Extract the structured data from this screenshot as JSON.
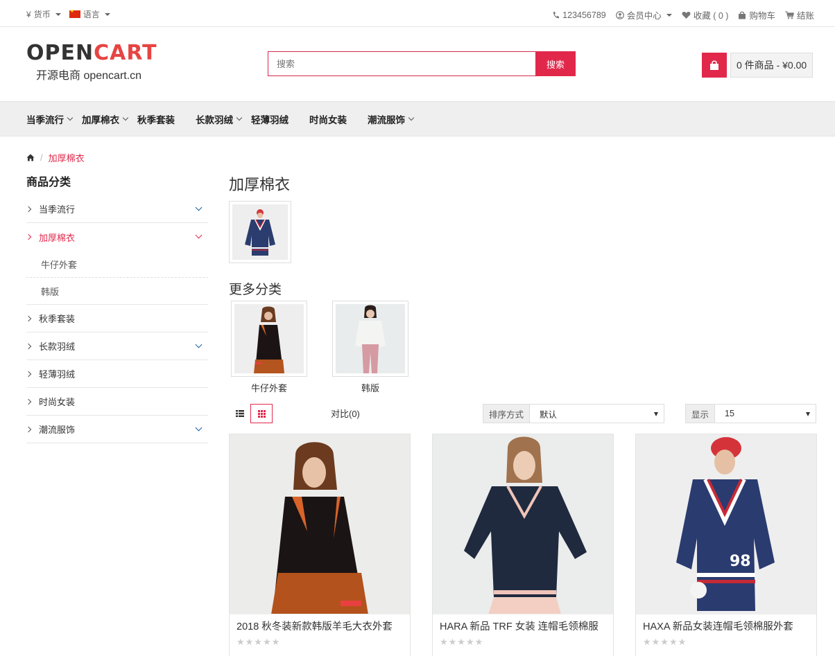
{
  "topbar": {
    "currency_symbol": "¥",
    "currency_label": "货币",
    "language_label": "语言",
    "phone": "123456789",
    "account_label": "会员中心",
    "wishlist_label": "收藏 ( 0 )",
    "cart_label": "购物车",
    "checkout_label": "结账"
  },
  "header": {
    "logo_part1": "OPEN",
    "logo_part2": "CART",
    "logo_tagline": "开源电商 opencart.cn",
    "search_placeholder": "搜索",
    "search_button": "搜索",
    "cart_total": "0 件商品 - ¥0.00"
  },
  "nav": {
    "items": [
      {
        "label": "当季流行",
        "dropdown": true
      },
      {
        "label": "加厚棉衣",
        "dropdown": true
      },
      {
        "label": "秋季套装",
        "dropdown": false
      },
      {
        "label": "长款羽绒",
        "dropdown": true
      },
      {
        "label": "轻薄羽绒",
        "dropdown": false
      },
      {
        "label": "时尚女装",
        "dropdown": false
      },
      {
        "label": "潮流服饰",
        "dropdown": true
      }
    ]
  },
  "breadcrumb": {
    "current": "加厚棉衣"
  },
  "sidebar": {
    "title": "商品分类",
    "items": [
      {
        "label": "当季流行"
      },
      {
        "label": "加厚棉衣"
      },
      {
        "label": "秋季套装"
      },
      {
        "label": "长款羽绒"
      },
      {
        "label": "轻薄羽绒"
      },
      {
        "label": "时尚女装"
      },
      {
        "label": "潮流服饰"
      }
    ],
    "subitems": [
      {
        "label": "牛仔外套"
      },
      {
        "label": "韩版"
      }
    ]
  },
  "main": {
    "title": "加厚棉衣",
    "more_title": "更多分类",
    "subcategories": [
      {
        "label": "牛仔外套"
      },
      {
        "label": "韩版"
      }
    ],
    "compare_label": "对比(0)",
    "sort_label": "排序方式",
    "sort_value": "默认",
    "show_label": "显示",
    "show_value": "15"
  },
  "products": [
    {
      "name": "2018 秋冬装新款韩版羊毛大衣外套",
      "rating": 0
    },
    {
      "name": "HARA 新品 TRF 女装 连帽毛领棉服",
      "rating": 0
    },
    {
      "name": "HAXA 新品女装连帽毛领棉服外套",
      "rating": 0
    }
  ],
  "colors": {
    "accent": "#e1284b",
    "brand_red": "#e64443",
    "nav_bg": "#efefef"
  }
}
